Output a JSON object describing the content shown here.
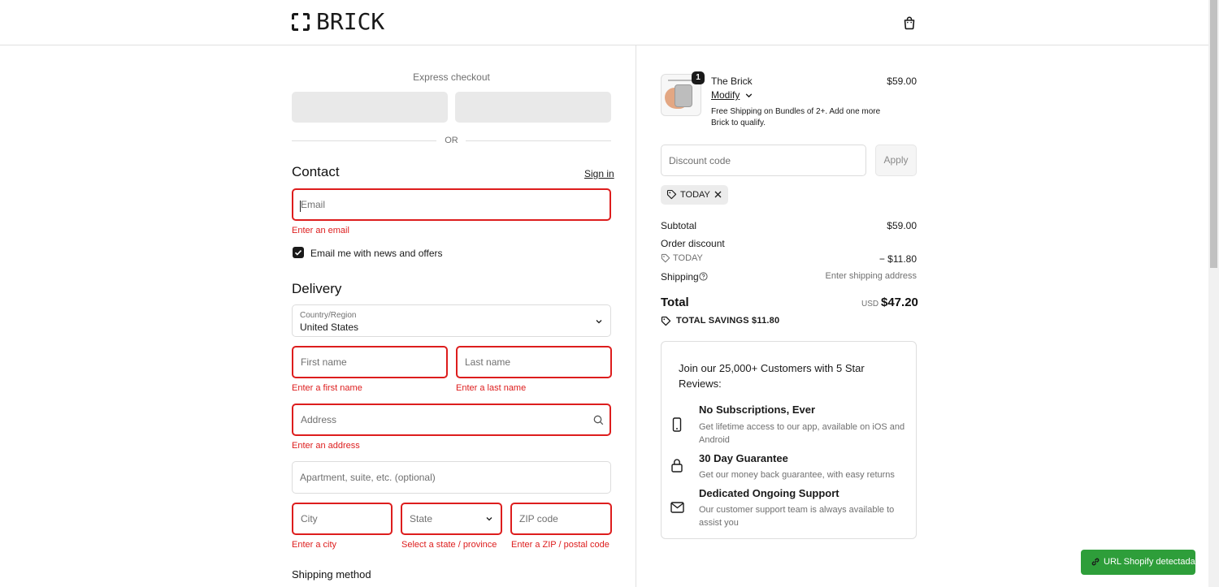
{
  "header": {
    "logo_text": "BRICK",
    "cart_icon": "shopping-bag-icon"
  },
  "express": {
    "label": "Express checkout",
    "or": "OR"
  },
  "contact": {
    "title": "Contact",
    "sign_in": "Sign in",
    "email_placeholder": "Email",
    "email_error": "Enter an email",
    "newsletter_label": "Email me with news and offers",
    "newsletter_checked": true
  },
  "delivery": {
    "title": "Delivery",
    "country_label": "Country/Region",
    "country_value": "United States",
    "first_name_placeholder": "First name",
    "first_name_error": "Enter a first name",
    "last_name_placeholder": "Last name",
    "last_name_error": "Enter a last name",
    "address_placeholder": "Address",
    "address_error": "Enter an address",
    "apartment_placeholder": "Apartment, suite, etc. (optional)",
    "city_placeholder": "City",
    "city_error": "Enter a city",
    "state_placeholder": "State",
    "state_error": "Select a state / province",
    "zip_placeholder": "ZIP code",
    "zip_error": "Enter a ZIP / postal code"
  },
  "shipping_method": {
    "title": "Shipping method"
  },
  "order": {
    "product": {
      "quantity": "1",
      "name": "The Brick",
      "modify": "Modify",
      "note": "Free Shipping on Bundles of 2+. Add one more Brick to qualify.",
      "price": "$59.00"
    },
    "discount_placeholder": "Discount code",
    "apply_label": "Apply",
    "applied_code": "TODAY",
    "subtotal_label": "Subtotal",
    "subtotal_value": "$59.00",
    "order_discount_label": "Order discount",
    "discount_code": "TODAY",
    "discount_value": "− $11.80",
    "shipping_label": "Shipping",
    "shipping_value": "Enter shipping address",
    "total_label": "Total",
    "currency": "USD",
    "total_value": "$47.20",
    "savings": "TOTAL SAVINGS  $11.80"
  },
  "promo": {
    "title": "Join our 25,000+ Customers with 5 Star Reviews:",
    "features": [
      {
        "icon": "phone-icon",
        "title": "No Subscriptions, Ever",
        "desc": "Get lifetime access to our app, available on iOS and Android"
      },
      {
        "icon": "lock-icon",
        "title": "30 Day Guarantee",
        "desc": "Get our money back guarantee, with easy returns"
      },
      {
        "icon": "mail-icon",
        "title": "Dedicated Ongoing Support",
        "desc": "Our customer support team is always available to assist you"
      }
    ]
  },
  "extension_badge": {
    "label": "URL Shopify detectada"
  },
  "colors": {
    "error": "#dd1d1d",
    "badge_green": "#2e9e3a",
    "button_gray": "#e9e9e9"
  }
}
